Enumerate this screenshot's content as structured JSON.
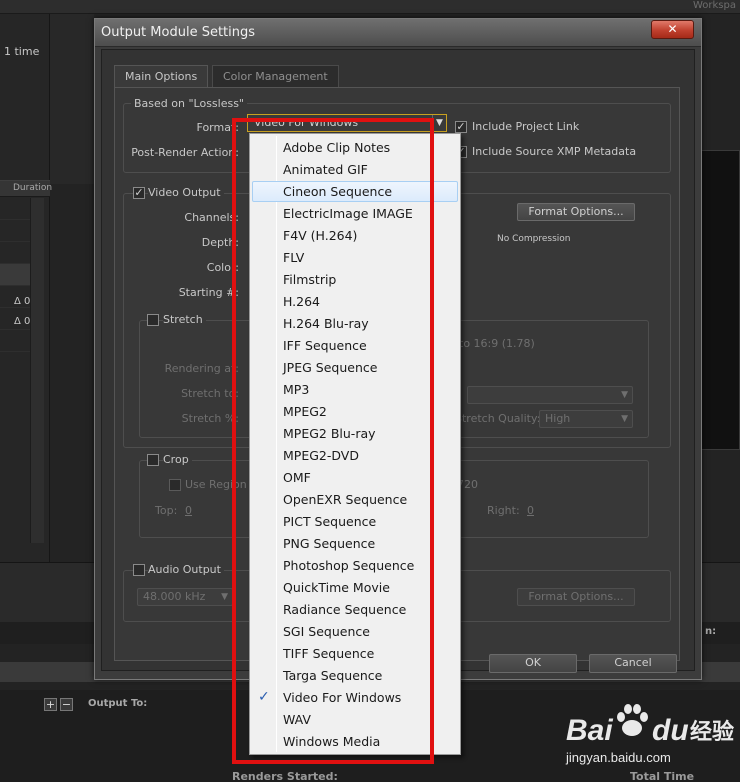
{
  "background": {
    "workspace_label": "Workspa",
    "time_label": "1 time",
    "duration_header": "Duration",
    "delta_1": "Δ 0",
    "delta_2": "Δ 0",
    "output_to_label": "Output To:",
    "renders_started_label": "Renders Started:",
    "total_time_label": "Total Time Elapsed",
    "right_label": "n:",
    "plus_label": "+",
    "minus_label": "−"
  },
  "dialog": {
    "title": "Output Module Settings",
    "close_glyph": "✕",
    "tabs": [
      {
        "label": "Main Options",
        "active": true
      },
      {
        "label": "Color Management",
        "active": false
      }
    ],
    "based_on": "Based on \"Lossless\"",
    "format_label": "Format:",
    "format_value": "Video For Windows",
    "post_render_label": "Post-Render Action:",
    "include_project_link": "Include Project Link",
    "include_xmp": "Include Source XMP Metadata",
    "video_output": {
      "label": "Video Output",
      "channels_label": "Channels:",
      "depth_label": "Depth:",
      "color_label": "Color:",
      "starting_label": "Starting #:",
      "format_options_button": "Format Options...",
      "compression_text": "No Compression"
    },
    "stretch": {
      "label": "Stretch",
      "ratio_text": "to 16:9 (1.78)",
      "rendering_at_label": "Rendering at:",
      "stretch_to_label": "Stretch to:",
      "stretch_pct_label": "Stretch %:",
      "stretch_quality_label": "Stretch Quality:",
      "stretch_quality_value": "High"
    },
    "crop": {
      "label": "Crop",
      "use_region_label": "Use Region",
      "size_text": "720",
      "top_label": "Top:",
      "top_value": "0",
      "right_label": "Right:",
      "right_value": "0"
    },
    "audio_output": {
      "label": "Audio Output",
      "sample_rate": "48.000 kHz",
      "format_options_button": "Format Options..."
    },
    "ok_button": "OK",
    "cancel_button": "Cancel"
  },
  "dropdown": {
    "selected": "Video For Windows",
    "hovered": "Cineon Sequence",
    "check_glyph": "✓",
    "items": [
      "Adobe Clip Notes",
      "Animated GIF",
      "Cineon Sequence",
      "ElectricImage IMAGE",
      "F4V (H.264)",
      "FLV",
      "Filmstrip",
      "H.264",
      "H.264 Blu-ray",
      "IFF Sequence",
      "JPEG Sequence",
      "MP3",
      "MPEG2",
      "MPEG2 Blu-ray",
      "MPEG2-DVD",
      "OMF",
      "OpenEXR Sequence",
      "PICT Sequence",
      "PNG Sequence",
      "Photoshop Sequence",
      "QuickTime Movie",
      "Radiance Sequence",
      "SGI Sequence",
      "TIFF Sequence",
      "Targa Sequence",
      "Video For Windows",
      "WAV",
      "Windows Media"
    ]
  },
  "watermark": {
    "bai": "Bai",
    "du": "du",
    "jingyan": "经验",
    "url": "jingyan.baidu.com"
  },
  "colors": {
    "highlight_box": "#e01010",
    "dialog_bg": "#3c3c3c",
    "menu_bg": "#f0f0f0",
    "close_button": "#c0402e"
  }
}
